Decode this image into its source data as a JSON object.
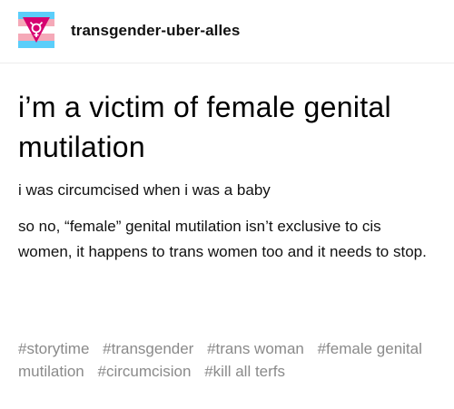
{
  "post": {
    "blog_name": "transgender-uber-alles",
    "avatar_icon": "transgender-flag-symbol-icon",
    "colors": {
      "flag_blue": "#5bcefa",
      "flag_pink": "#f5a9b8",
      "flag_white": "#ffffff",
      "symbol_magenta": "#d60270",
      "tag_gray": "#8a8a8a"
    },
    "title": "i’m a victim of female genital mutilation",
    "paragraphs": [
      "i was circumcised when i was a baby",
      "so no, “female” genital mutilation isn’t exclusive to cis women, it happens to trans women too and it needs to stop."
    ],
    "tags": [
      "#storytime",
      "#transgender",
      "#trans woman",
      "#female genital mutilation",
      "#circumcision",
      "#kill all terfs"
    ]
  }
}
